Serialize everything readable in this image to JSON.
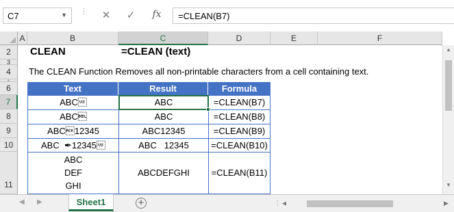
{
  "formula_bar": {
    "name_box": "C7",
    "cancel_glyph": "✕",
    "enter_glyph": "✓",
    "fx_label": "fx",
    "formula": "=CLEAN(B7)"
  },
  "columns": [
    "A",
    "B",
    "C",
    "D",
    "E",
    "F"
  ],
  "rows": [
    "2",
    "3",
    "4",
    "5",
    "6",
    "7",
    "8",
    "9",
    "10",
    "11"
  ],
  "selected_cell": {
    "column": "C",
    "row": "7"
  },
  "sheet": {
    "title": "CLEAN",
    "syntax": "=CLEAN (text)",
    "description": "The CLEAN Function Removes all non-printable characters from a cell containing text.",
    "table": {
      "headers": [
        "Text",
        "Result",
        "Formula"
      ],
      "rows": [
        {
          "text": "ABC\u001f",
          "result": "ABC",
          "formula": "=CLEAN(B7)"
        },
        {
          "text": "ABC\u0007",
          "result": "ABC",
          "formula": "=CLEAN(B8)"
        },
        {
          "text": "ABC\u000612345",
          "result": "ABC12345",
          "formula": "=CLEAN(B9)"
        },
        {
          "text": "ABC  ✒12345\u001f",
          "result": "ABC   12345",
          "formula": "=CLEAN(B10)"
        },
        {
          "text_lines": [
            "ABC",
            "DEF",
            "GHI"
          ],
          "result": "ABCDEFGHI",
          "formula": "=CLEAN(B11)"
        }
      ]
    }
  },
  "tabs": {
    "active": "Sheet1",
    "add_glyph": "+"
  },
  "colors": {
    "accent": "#217346",
    "table_header": "#4472c4",
    "table_border": "#4472c4"
  }
}
